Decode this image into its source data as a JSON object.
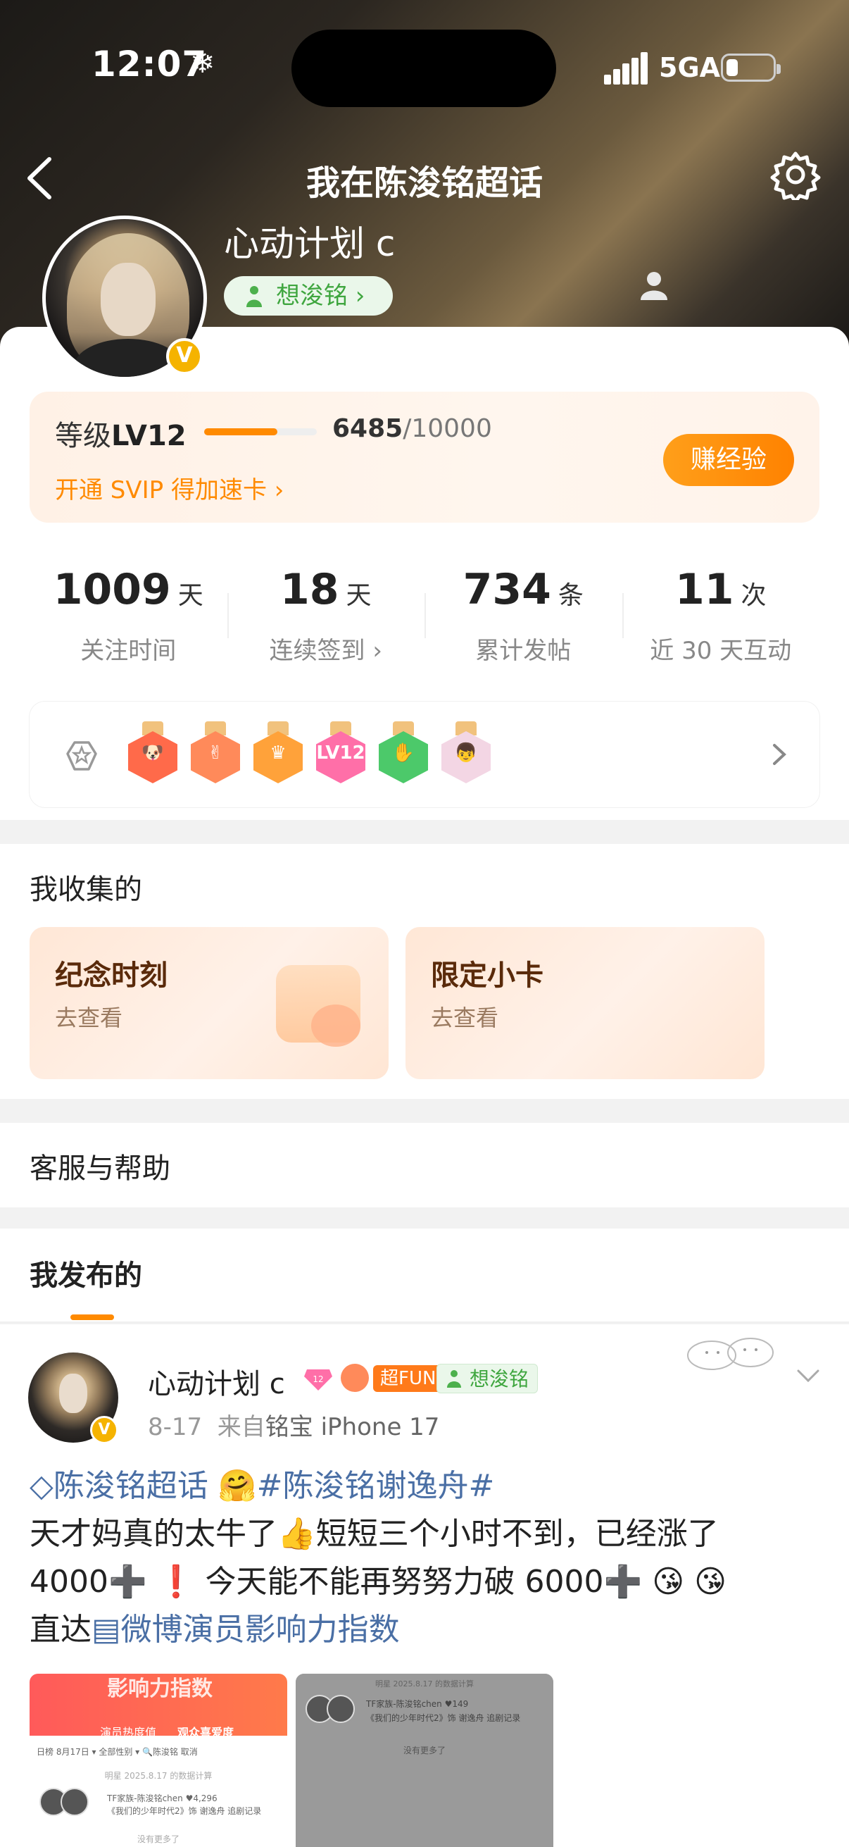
{
  "status_bar": {
    "time": "12:07",
    "weather_glyph": "❄",
    "network": "5GA"
  },
  "header": {
    "title": "我在陈浚铭超话"
  },
  "profile": {
    "username": "心动计划 c",
    "fan_tag": "想浚铭 ›",
    "verified_glyph": "V"
  },
  "level": {
    "label": "等级",
    "value": "LV12",
    "progress_current": "6485",
    "progress_total": "/10000",
    "progress_fraction": 0.6485,
    "promo_link": "开通 SVIP 得加速卡 ›",
    "earn_button": "赚经验"
  },
  "stats": [
    {
      "value": "1009",
      "unit": "天",
      "label": "关注时间"
    },
    {
      "value": "18",
      "unit": "天",
      "label": "连续签到 ›"
    },
    {
      "value": "734",
      "unit": "条",
      "label": "累计发帖"
    },
    {
      "value": "11",
      "unit": "次",
      "label": "近 30 天互动"
    }
  ],
  "badges": {
    "items": [
      {
        "icon": "dog-medal-icon",
        "color": "#ff6a4a",
        "glyph": "🐶"
      },
      {
        "icon": "hands-medal-icon",
        "color": "#ff8a5a",
        "glyph": "✌"
      },
      {
        "icon": "crown-medal-icon",
        "color": "#ffa23a",
        "glyph": "♛"
      },
      {
        "icon": "lv12-medal-icon",
        "color": "#ff6fa8",
        "glyph": "LV12"
      },
      {
        "icon": "hand-medal-icon",
        "color": "#4cc96a",
        "glyph": "✋"
      },
      {
        "icon": "chibi-figure-icon",
        "color": "#f3d6e4",
        "glyph": "👦"
      }
    ]
  },
  "collections": {
    "title": "我收集的",
    "cards": [
      {
        "title": "纪念时刻",
        "sub": "去查看"
      },
      {
        "title": "限定小卡",
        "sub": "去查看"
      }
    ]
  },
  "help": {
    "title": "客服与帮助"
  },
  "posts_section": {
    "title": "我发布的"
  },
  "post": {
    "author": "心动计划 c",
    "tag_fun": "超FUN",
    "tag_fan": "想浚铭",
    "date": "8-17",
    "source_prefix": "来自",
    "source": "铭宝 iPhone 17",
    "line1_link1": "◇陈浚铭超话",
    "line1_emoji": "🤗",
    "line1_link2": "#陈浚铭谢逸舟#",
    "line2": "天才妈真的太牛了👍短短三个小时不到，已经涨了",
    "line3": "4000➕ ❗ 今天能不能再努努力破 6000➕ 😘 😘",
    "line4_prefix": "直达",
    "line4_link": "▤微博演员影响力指数",
    "thumb1_title": "影响力指数",
    "thumb1_tab1": "演员热度值",
    "thumb1_tab2": "观众喜爱度",
    "thumb1_row1": "日榜 8月17日 ▾   全部性别 ▾   🔍陈浚铭            取消",
    "thumb1_row2": "明星 2025.8.17 的数据计算",
    "thumb1_row3": "TF家族-陈浚铭chen     ♥4,296",
    "thumb1_row4": "《我们的少年时代2》饰 谢逸舟  追剧记录",
    "thumb1_row5": "没有更多了",
    "thumb2_row0": "明星 2025.8.17 的数据计算",
    "thumb2_row1": "TF家族-陈浚铭chen          ♥149",
    "thumb2_row2": "《我们的少年时代2》饰 谢逸舟  追剧记录",
    "thumb2_row3": "没有更多了"
  }
}
